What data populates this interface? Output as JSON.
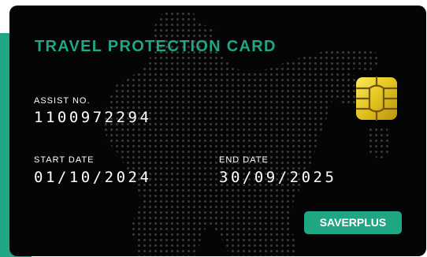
{
  "card": {
    "title": "TRAVEL PROTECTION CARD",
    "assist_label": "ASSIST NO.",
    "assist_no": "1100972294",
    "start_label": "START DATE",
    "start_date": "01/10/2024",
    "end_label": "END DATE",
    "end_date": "30/09/2025",
    "plan_badge": "SAVERPLUS"
  },
  "colors": {
    "accent": "#1fa685",
    "card_bg": "#050505",
    "chip_gold": "#e3c31e"
  },
  "icons": {
    "chip": "chip-icon",
    "map": "world-map-icon"
  }
}
